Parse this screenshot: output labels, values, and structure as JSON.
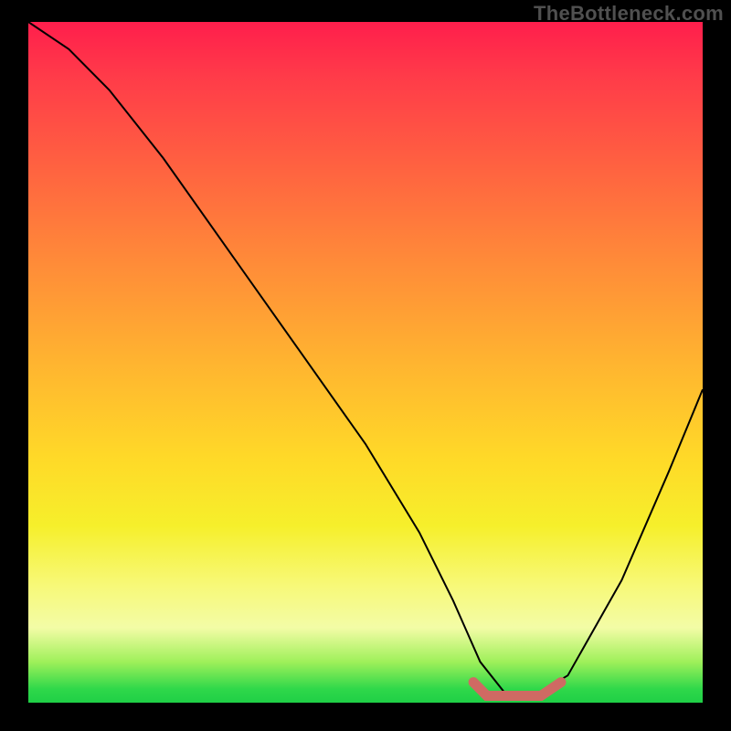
{
  "watermark": "TheBottleneck.com",
  "chart_data": {
    "type": "line",
    "title": "",
    "xlabel": "",
    "ylabel": "",
    "xlim": [
      0,
      100
    ],
    "ylim": [
      0,
      100
    ],
    "series": [
      {
        "name": "bottleneck-curve",
        "x": [
          0,
          6,
          12,
          20,
          30,
          40,
          50,
          58,
          63,
          67,
          71,
          75,
          80,
          88,
          95,
          100
        ],
        "y": [
          100,
          96,
          90,
          80,
          66,
          52,
          38,
          25,
          15,
          6,
          1,
          1,
          4,
          18,
          34,
          46
        ]
      },
      {
        "name": "optimal-marker",
        "x": [
          66,
          68,
          72,
          76,
          79
        ],
        "y": [
          3,
          1,
          1,
          1,
          3
        ]
      }
    ],
    "gradient_stops": [
      {
        "pos": 0,
        "color": "#ff1e4c"
      },
      {
        "pos": 50,
        "color": "#ffb430"
      },
      {
        "pos": 83,
        "color": "#f7f97a"
      },
      {
        "pos": 100,
        "color": "#1fcf46"
      }
    ]
  }
}
